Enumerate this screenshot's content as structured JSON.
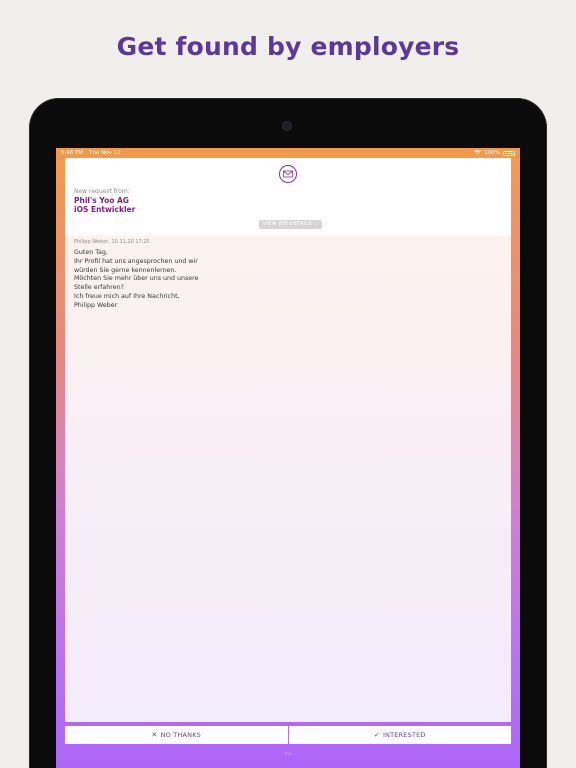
{
  "headline": "Get found by employers",
  "status_bar": {
    "time": "5:46 PM",
    "date": "Thu Nov 12",
    "battery": "100%"
  },
  "request": {
    "label": "New request from:",
    "company": "Phil's Yoo AG",
    "position": "iOS Entwickler",
    "view_details": "VIEW JOB DETAILS"
  },
  "message": {
    "meta": "Philipp Weber, 10.11.20 17:25",
    "lines": [
      "Guten Tag,",
      "Ihr Profil hat uns angesprochen und wir",
      "würden Sie gerne kennenlernen.",
      "Möchten Sie mehr über uns und unsere",
      "Stelle erfahren?",
      "Ich freue mich auf Ihre Nachricht,",
      "Philipp Weber"
    ]
  },
  "actions": {
    "decline": "NO THANKS",
    "accept": "INTERESTED"
  },
  "home_hint": "Yoo",
  "icons": {
    "mail": "envelope-icon",
    "decline": "x-icon",
    "accept": "checkmark-icon",
    "details": "chevron-down-icon"
  },
  "colors": {
    "brand": "#5a3a96",
    "accent": "#7b1f82"
  }
}
